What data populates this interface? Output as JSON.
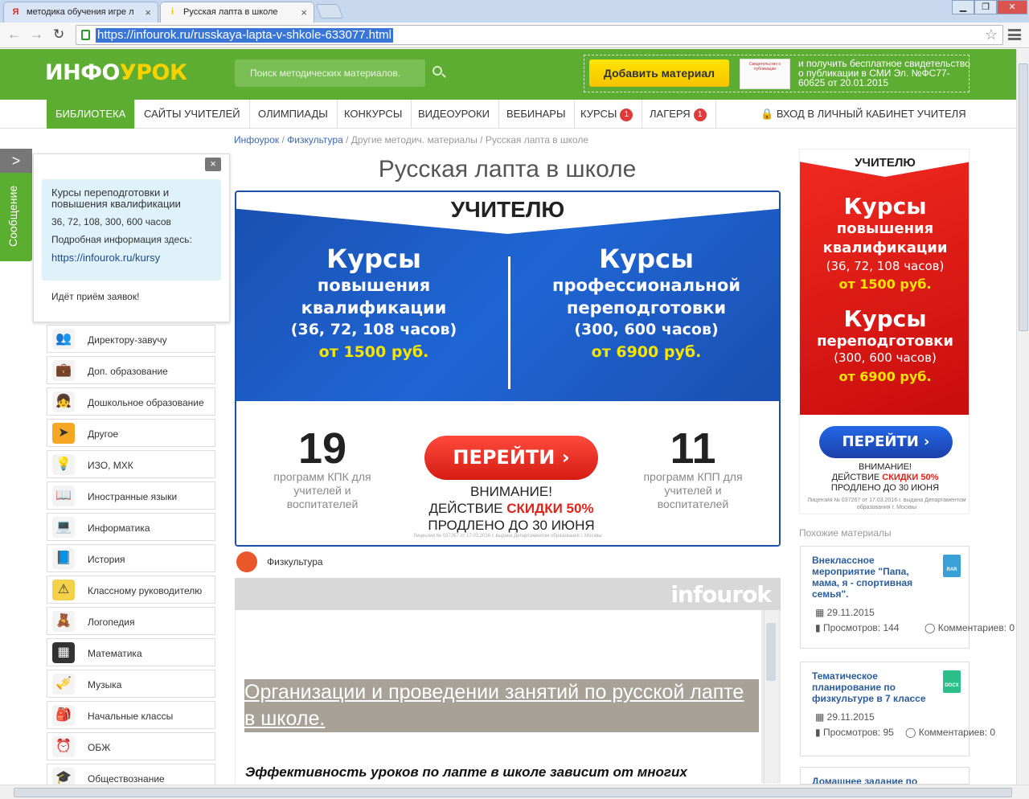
{
  "browser": {
    "tabs": [
      {
        "label": "методика обучения игре л",
        "icon": "yandex-icon"
      },
      {
        "label": "Русская лапта в школе",
        "icon": "infourok-icon"
      }
    ],
    "url": "https://infourok.ru/russkaya-lapta-v-shkole-633077.html"
  },
  "header": {
    "logo_prefix": "ИНФО",
    "logo_suffix": "УРОК",
    "search_placeholder": "Поиск методических материалов.",
    "add_material": "Добавить материал",
    "cert_text": "Свидетельство о публикации",
    "promo_text": "и получить бесплатное свидетельство о публикации в СМИ Эл. №ФС77-60625 от 20.01.2015"
  },
  "nav": {
    "items": [
      {
        "label": "БИБЛИОТЕКА"
      },
      {
        "label": "САЙТЫ УЧИТЕЛЕЙ"
      },
      {
        "label": "ОЛИМПИАДЫ"
      },
      {
        "label": "КОНКУРСЫ"
      },
      {
        "label": "ВИДЕОУРОКИ"
      },
      {
        "label": "ВЕБИНАРЫ"
      },
      {
        "label": "КУРСЫ",
        "badge": "1"
      },
      {
        "label": "ЛАГЕРЯ",
        "badge": "1"
      }
    ],
    "login": "ВХОД В ЛИЧНЫЙ КАБИНЕТ УЧИТЕЛЯ"
  },
  "breadcrumb": {
    "items": [
      "Инфоурок",
      "Физкультура",
      "Другие методич. материалы",
      "Русская лапта в школе"
    ],
    "sep": " / "
  },
  "page_title": "Русская лапта в школе",
  "banner": {
    "header": "УЧИТЕЛЮ",
    "left": {
      "l1": "Курсы",
      "l2": "повышения",
      "l3": "квалификации",
      "l4": "(36, 72, 108 часов)",
      "price": "от 1500 руб."
    },
    "right": {
      "l1": "Курсы",
      "l2": "профессиональной",
      "l3": "переподготовки",
      "l4": "(300, 600 часов)",
      "price": "от 6900 руб."
    },
    "num_left": "19",
    "sub_left": "программ КПК для учителей и воспитателей",
    "num_right": "11",
    "sub_right": "программ КПП для учителей и воспитателей",
    "go": "ПЕРЕЙТИ",
    "warn1": "ВНИМАНИЕ!",
    "warn2a": "ДЕЙСТВИЕ ",
    "warn2b": "СКИДКИ 50%",
    "warn3": "ПРОДЛЕНО ДО 30 ИЮНЯ",
    "license": "Лицензия № 037267 от 17.03.2016 г. выдана Департаментом образования г. Москвы"
  },
  "subject": "Физкультура",
  "viewer": {
    "logo": "infourok",
    "heading": "Организации и проведении занятий по русской лапте в школе.",
    "body": "Эффективность уроков по лапте в школе зависит от многих факторов. Этот процесс требует от учителя физической культуры знания основ теории физического воспитания."
  },
  "sidebar": {
    "message_tab": "Сообщение",
    "popup": {
      "title": "Курсы переподготовки и повышения квалификации",
      "hours": "36, 72, 108, 300, 600 часов",
      "more": "Подробная информация здесь:",
      "link": "https://infourok.ru/kursy",
      "footer": "Идёт приём заявок!"
    },
    "categories": [
      {
        "label": "Директору-завучу",
        "icon": "people-icon",
        "glyph": "👥",
        "color": "#f3f3f3"
      },
      {
        "label": "Доп. образование",
        "icon": "briefcase-icon",
        "glyph": "💼",
        "color": "#f3f3f3"
      },
      {
        "label": "Дошкольное образование",
        "icon": "child-icon",
        "glyph": "👧",
        "color": "#f3f3f3"
      },
      {
        "label": "Другое",
        "icon": "paper-plane-icon",
        "glyph": "➤",
        "color": "#f5a623"
      },
      {
        "label": "ИЗО, МХК",
        "icon": "lightbulb-icon",
        "glyph": "💡",
        "color": "#f3f3f3"
      },
      {
        "label": "Иностранные языки",
        "icon": "book-icon",
        "glyph": "📖",
        "color": "#f3f3f3"
      },
      {
        "label": "Информатика",
        "icon": "laptop-icon",
        "glyph": "💻",
        "color": "#f3f3f3"
      },
      {
        "label": "История",
        "icon": "open-book-icon",
        "glyph": "📘",
        "color": "#f3f3f3"
      },
      {
        "label": "Классному руководителю",
        "icon": "sign-icon",
        "glyph": "⚠",
        "color": "#f3d24a"
      },
      {
        "label": "Логопедия",
        "icon": "bear-icon",
        "glyph": "🧸",
        "color": "#f3f3f3"
      },
      {
        "label": "Математика",
        "icon": "calculator-icon",
        "glyph": "▦",
        "color": "#333"
      },
      {
        "label": "Музыка",
        "icon": "trumpet-icon",
        "glyph": "🎺",
        "color": "#f3f3f3"
      },
      {
        "label": "Начальные классы",
        "icon": "backpack-icon",
        "glyph": "🎒",
        "color": "#f3f3f3"
      },
      {
        "label": "ОБЖ",
        "icon": "alarm-clock-icon",
        "glyph": "⏰",
        "color": "#f3f3f3"
      },
      {
        "label": "Обществознание",
        "icon": "graduation-cap-icon",
        "glyph": "🎓",
        "color": "#f3f3f3"
      }
    ]
  },
  "right_banner": {
    "header": "УЧИТЕЛЮ",
    "k1": "Курсы",
    "k1a": "повышения",
    "k1b": "квалификации",
    "k1c": "(36, 72, 108 часов)",
    "k1p": "от 1500 руб.",
    "k2": "Курсы",
    "k2a": "переподготовки",
    "k2c": "(300, 600 часов)",
    "k2p": "от 6900 руб.",
    "go": "ПЕРЕЙТИ",
    "warn1": "ВНИМАНИЕ!",
    "warn2a": "ДЕЙСТВИЕ ",
    "warn2b": "СКИДКИ 50%",
    "warn3": "ПРОДЛЕНО ДО 30 ИЮНЯ",
    "license": "Лицензия № 037267 от 17.03.2016 г. выдана Департаментом образования г. Москвы"
  },
  "similar": {
    "label": "Похожие материалы",
    "items": [
      {
        "title": "Внеклассное мероприятие \"Папа, мама, я - спортивная семья\".",
        "type": "RAR",
        "type_color": "#3aa0d8",
        "date": "29.11.2015",
        "views": "Просмотров: 144",
        "comments": "Комментариев: 0"
      },
      {
        "title": "Тематическое планирование по физкультуре в 7 классе",
        "type": "DOCX",
        "type_color": "#2bbf8a",
        "date": "29.11.2015",
        "views": "Просмотров: 95",
        "comments": "Комментариев: 0"
      },
      {
        "title": "Домашнее задание по"
      }
    ]
  }
}
